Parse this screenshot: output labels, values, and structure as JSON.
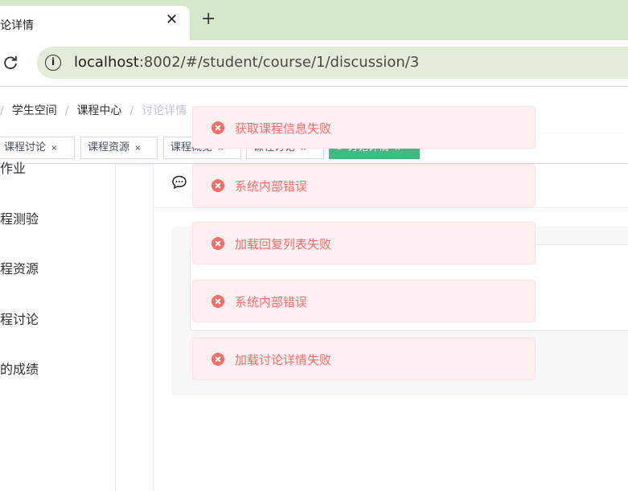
{
  "browser": {
    "tab_title": "论详情",
    "tab_close": "✕",
    "new_tab": "+",
    "url_host": "localhost",
    "url_path": ":8002/#/student/course/1/discussion/3"
  },
  "breadcrumb": {
    "lead_sep": "/",
    "items": [
      "学生空间",
      "课程中心",
      "讨论详情"
    ],
    "sep": "/"
  },
  "tags": [
    {
      "label": "课程讨论",
      "close": "×"
    },
    {
      "label": "课程资源",
      "close": "×"
    },
    {
      "label": "课程概览",
      "close": "×"
    },
    {
      "label": "课程讨论",
      "close": "×"
    },
    {
      "label": "讨论详情",
      "close": "×"
    }
  ],
  "sidebar": {
    "items": [
      "作业",
      "程测验",
      "程资源",
      "程讨论",
      "的成绩"
    ]
  },
  "messages": [
    {
      "text": "获取课程信息失败"
    },
    {
      "text": "系统内部错误"
    },
    {
      "text": "加载回复列表失败"
    },
    {
      "text": "系统内部错误"
    },
    {
      "text": "加载讨论详情失败"
    }
  ],
  "colors": {
    "error": "#f56c6c",
    "error_bg": "#fef0f0",
    "active_tag": "#42b983",
    "browser_chrome": "#d7e7c9"
  },
  "icons": {
    "reload": "reload-icon",
    "site_info": "info-icon",
    "chat": "chat-icon",
    "error": "error-circle-icon"
  }
}
